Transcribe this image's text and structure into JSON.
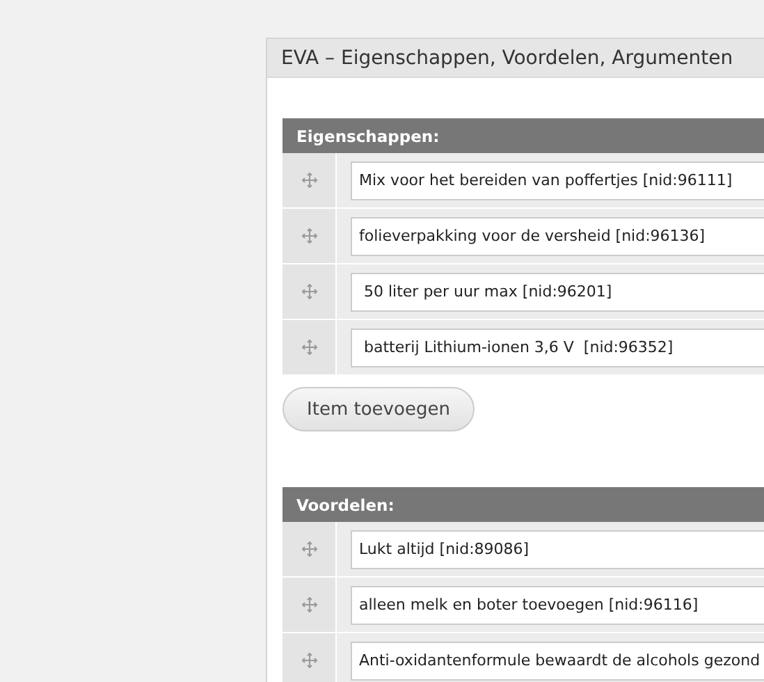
{
  "panel": {
    "title": "EVA – Eigenschappen, Voordelen, Argumenten"
  },
  "sections": [
    {
      "heading": "Eigenschappen:",
      "items": [
        "Mix voor het bereiden van poffertjes [nid:96111]",
        "folieverpakking voor de versheid [nid:96136]",
        " 50 liter per uur max [nid:96201]",
        " batterij Lithium-ionen 3,6 V  [nid:96352]"
      ],
      "button": "Item toevoegen"
    },
    {
      "heading": "Voordelen:",
      "items": [
        "Lukt altijd [nid:89086]",
        "alleen melk en boter toevoegen [nid:96116]",
        "Anti-oxidantenformule bewaardt de alcohols gezond"
      ]
    }
  ]
}
